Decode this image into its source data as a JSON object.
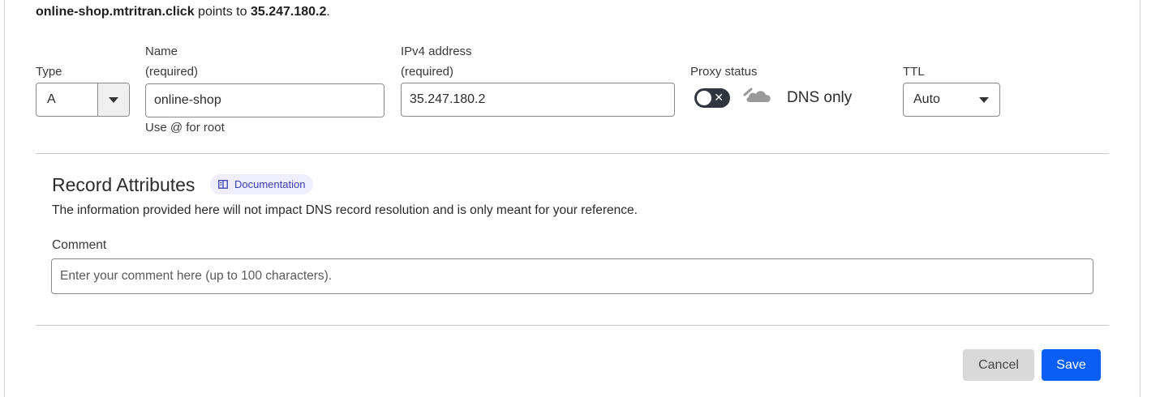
{
  "summary": {
    "name": "online-shop.mtritran.click",
    "middle": " points to ",
    "target": "35.247.180.2",
    "end": "."
  },
  "fields": {
    "type": {
      "label": "Type",
      "value": "A"
    },
    "name": {
      "label_line1": "Name",
      "label_line2": "(required)",
      "value": "online-shop",
      "hint": "Use @ for root"
    },
    "ipv4": {
      "label_line1": "IPv4 address",
      "label_line2": "(required)",
      "value": "35.247.180.2"
    },
    "proxy": {
      "label": "Proxy status",
      "toggle_on": false,
      "status_text": "DNS only",
      "icon": "cloud-icon"
    },
    "ttl": {
      "label": "TTL",
      "value": "Auto"
    }
  },
  "attributes": {
    "title": "Record Attributes",
    "doc_badge": "Documentation",
    "description": "The information provided here will not impact DNS record resolution and is only meant for your reference.",
    "comment_label": "Comment",
    "comment_placeholder": "Enter your comment here (up to 100 characters).",
    "comment_value": ""
  },
  "buttons": {
    "cancel": "Cancel",
    "save": "Save"
  },
  "colors": {
    "primary": "#0a5df5",
    "toggle_off": "#2f3640",
    "badge_bg": "#eeeefd",
    "badge_text": "#3c3cb4"
  }
}
